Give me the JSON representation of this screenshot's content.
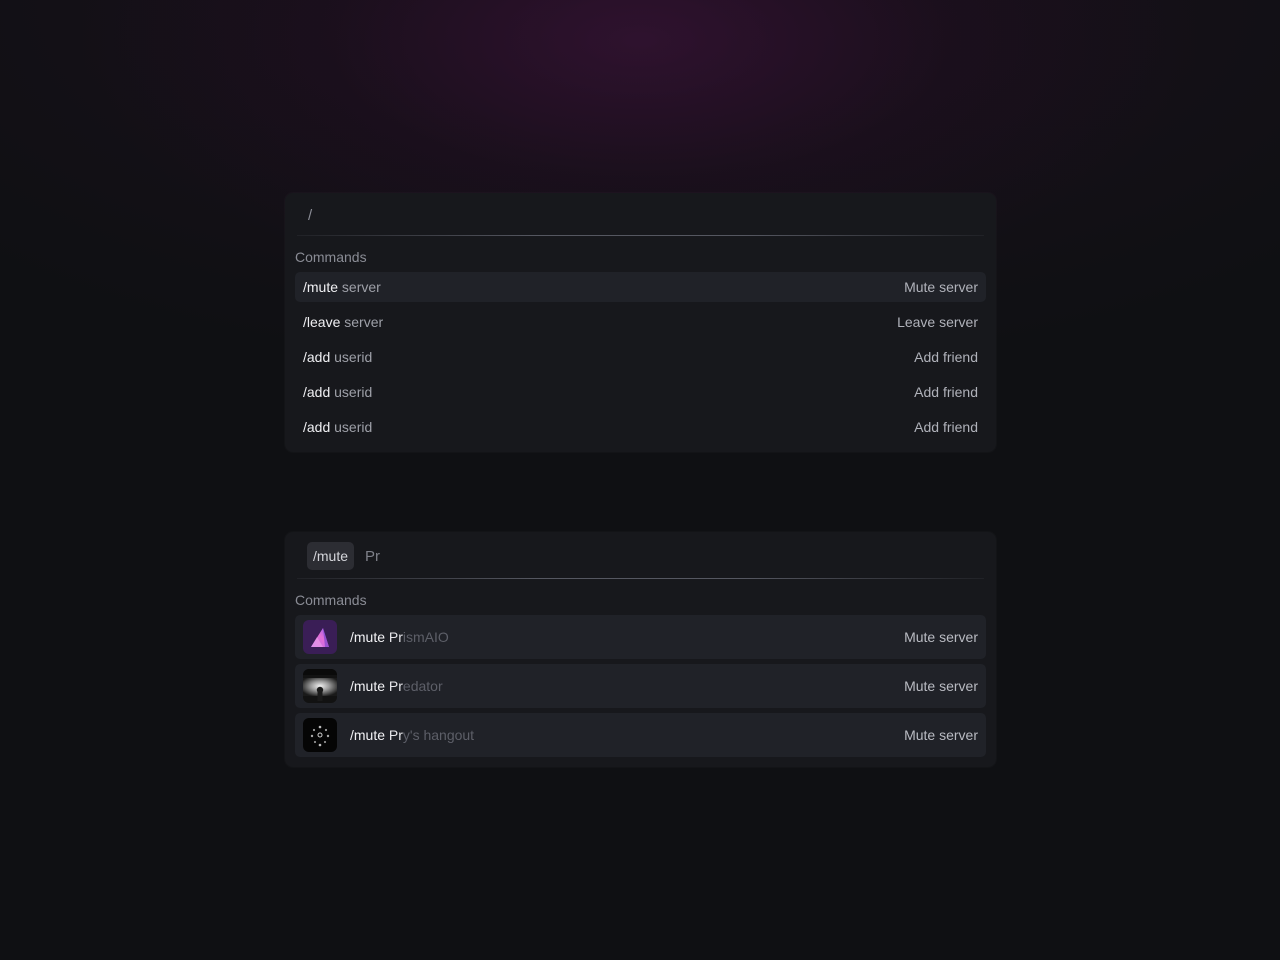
{
  "palette_top": {
    "input": {
      "value": "/"
    },
    "section_label": "Commands",
    "commands": [
      {
        "name": "/mute",
        "arg": "server",
        "description": "Mute server",
        "highlighted": true
      },
      {
        "name": "/leave",
        "arg": "server",
        "description": "Leave server",
        "highlighted": false
      },
      {
        "name": "/add",
        "arg": "userid",
        "description": "Add friend",
        "highlighted": false
      },
      {
        "name": "/add",
        "arg": "userid",
        "description": "Add friend",
        "highlighted": false
      },
      {
        "name": "/add",
        "arg": "userid",
        "description": "Add friend",
        "highlighted": false
      }
    ]
  },
  "palette_bottom": {
    "input": {
      "command_chip": "/mute",
      "query": "Pr"
    },
    "section_label": "Commands",
    "servers": [
      {
        "command": "/mute",
        "typed": "Pr",
        "completion": "ismAIO",
        "description": "Mute server",
        "icon": "prism-logo-icon"
      },
      {
        "command": "/mute",
        "typed": "Pr",
        "completion": "edator",
        "description": "Mute server",
        "icon": "predator-avatar-icon"
      },
      {
        "command": "/mute",
        "typed": "Pr",
        "completion": "y's hangout",
        "description": "Mute server",
        "icon": "hangout-dots-icon"
      }
    ]
  },
  "colors": {
    "background": "#0f1013",
    "panel": "#17181c",
    "row_highlight": "#202228",
    "accent_purple": "#9b5de5"
  }
}
